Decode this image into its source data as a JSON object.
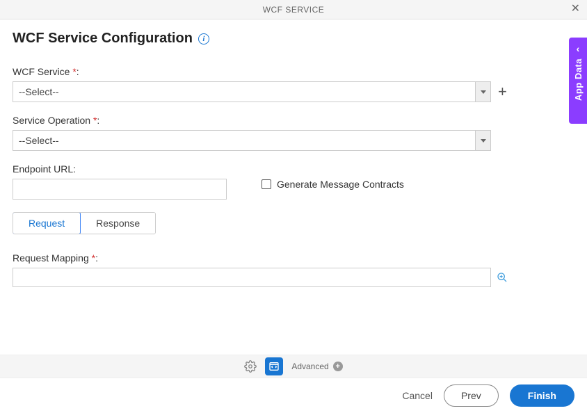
{
  "titlebar": {
    "text": "WCF SERVICE"
  },
  "page_title": "WCF Service Configuration",
  "fields": {
    "wcf_service": {
      "label": "WCF Service",
      "value": "--Select--"
    },
    "service_operation": {
      "label": "Service Operation",
      "value": "--Select--"
    },
    "endpoint_url": {
      "label": "Endpoint URL:",
      "value": ""
    },
    "generate_contracts": {
      "label": "Generate Message Contracts",
      "checked": false
    },
    "request_mapping": {
      "label": "Request Mapping",
      "value": ""
    }
  },
  "tabs": {
    "request": "Request",
    "response": "Response"
  },
  "side_panel": {
    "label": "App Data"
  },
  "bottom_bar": {
    "advanced": "Advanced"
  },
  "footer": {
    "cancel": "Cancel",
    "prev": "Prev",
    "finish": "Finish"
  }
}
